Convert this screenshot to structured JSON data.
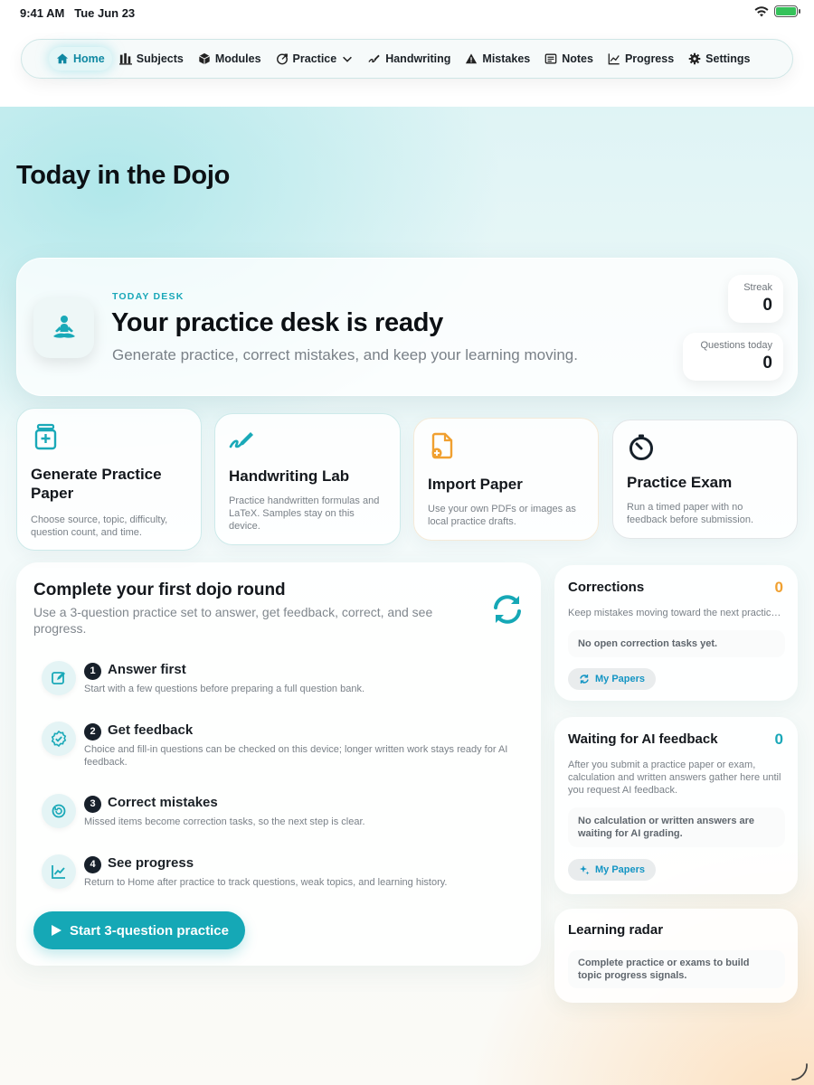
{
  "status": {
    "time": "9:41 AM",
    "date": "Tue Jun 23"
  },
  "nav": {
    "items": [
      {
        "label": "Home",
        "icon": "home-icon",
        "active": true
      },
      {
        "label": "Subjects",
        "icon": "bar-chart-icon"
      },
      {
        "label": "Modules",
        "icon": "cube-icon"
      },
      {
        "label": "Practice",
        "icon": "target-icon",
        "dropdown": true
      },
      {
        "label": "Handwriting",
        "icon": "handwriting-icon"
      },
      {
        "label": "Mistakes",
        "icon": "warning-icon"
      },
      {
        "label": "Notes",
        "icon": "note-icon"
      },
      {
        "label": "Progress",
        "icon": "line-chart-icon"
      },
      {
        "label": "Settings",
        "icon": "gear-icon"
      }
    ]
  },
  "page": {
    "title": "Today in the Dojo"
  },
  "desk": {
    "kicker": "TODAY DESK",
    "title": "Your practice desk is ready",
    "subtitle": "Generate practice, correct mistakes, and keep your learning moving.",
    "stats": {
      "streak_label": "Streak",
      "streak_value": "0",
      "questions_label": "Questions today",
      "questions_value": "0"
    }
  },
  "cards": {
    "generate": {
      "title": "Generate Practice Paper",
      "desc": "Choose source, topic, difficulty, question count, and time."
    },
    "handwriting": {
      "title": "Handwriting Lab",
      "desc": "Practice handwritten formulas and LaTeX. Samples stay on this device."
    },
    "import": {
      "title": "Import Paper",
      "desc": "Use your own PDFs or images as local practice drafts."
    },
    "exam": {
      "title": "Practice Exam",
      "desc": "Run a timed paper with no feedback before submission."
    }
  },
  "round": {
    "title": "Complete your first dojo round",
    "subtitle": "Use a 3-question practice set to answer, get feedback, correct, and see progress.",
    "steps": [
      {
        "num": "1",
        "title": "Answer first",
        "desc": "Start with a few questions before preparing a full question bank.",
        "icon": "edit-icon"
      },
      {
        "num": "2",
        "title": "Get feedback",
        "desc": "Choice and fill-in questions can be checked on this device; longer written work stays ready for AI feedback.",
        "icon": "check-badge-icon"
      },
      {
        "num": "3",
        "title": "Correct mistakes",
        "desc": "Missed items become correction tasks, so the next step is clear.",
        "icon": "retry-icon"
      },
      {
        "num": "4",
        "title": "See progress",
        "desc": "Return to Home after practice to track questions, weak topics, and learning history.",
        "icon": "trend-icon"
      }
    ],
    "start_label": "Start 3-question practice"
  },
  "corrections": {
    "title": "Corrections",
    "count": "0",
    "desc": "Keep mistakes moving toward the next practic…",
    "empty": "No open correction tasks yet.",
    "button": "My Papers"
  },
  "waiting": {
    "title": "Waiting for AI feedback",
    "count": "0",
    "desc": "After you submit a practice paper or exam, calculation and written answers gather here until you request AI feedback.",
    "empty": "No calculation or written answers are waiting for AI grading.",
    "button": "My Papers"
  },
  "radar": {
    "title": "Learning radar",
    "empty": "Complete practice or exams to build topic progress signals."
  },
  "colors": {
    "accent": "#15a8b6",
    "orange": "#f0a030",
    "teal_count": "#19a7b8",
    "text": "#14181d"
  }
}
